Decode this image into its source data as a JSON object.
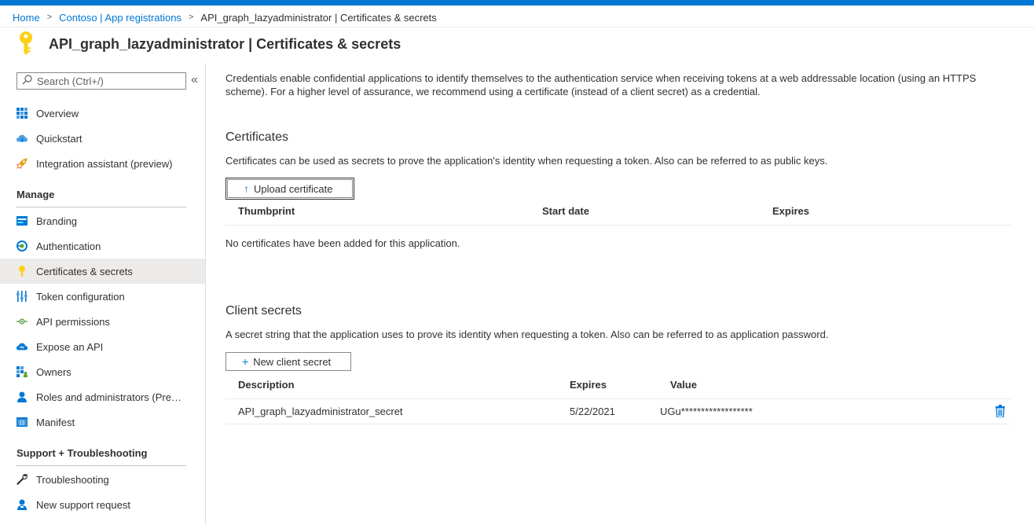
{
  "breadcrumb": {
    "home": "Home",
    "parent": "Contoso | App registrations",
    "current": "API_graph_lazyadministrator | Certificates & secrets"
  },
  "page": {
    "title": "API_graph_lazyadministrator | Certificates & secrets"
  },
  "sidebar": {
    "search_placeholder": "Search (Ctrl+/)",
    "collapse_glyph": "«",
    "top_items": [
      {
        "label": "Overview",
        "icon": "overview-icon"
      },
      {
        "label": "Quickstart",
        "icon": "quickstart-icon"
      },
      {
        "label": "Integration assistant (preview)",
        "icon": "rocket-icon"
      }
    ],
    "manage_header": "Manage",
    "manage_items": [
      {
        "label": "Branding",
        "icon": "branding-icon"
      },
      {
        "label": "Authentication",
        "icon": "authentication-icon"
      },
      {
        "label": "Certificates & secrets",
        "icon": "key-icon",
        "selected": true
      },
      {
        "label": "Token configuration",
        "icon": "token-icon"
      },
      {
        "label": "API permissions",
        "icon": "api-permissions-icon"
      },
      {
        "label": "Expose an API",
        "icon": "cloud-icon"
      },
      {
        "label": "Owners",
        "icon": "owners-icon"
      },
      {
        "label": "Roles and administrators (Previ...",
        "icon": "roles-icon"
      },
      {
        "label": "Manifest",
        "icon": "manifest-icon"
      }
    ],
    "support_header": "Support + Troubleshooting",
    "support_items": [
      {
        "label": "Troubleshooting",
        "icon": "wrench-icon"
      },
      {
        "label": "New support request",
        "icon": "support-person-icon"
      }
    ]
  },
  "main": {
    "intro": "Credentials enable confidential applications to identify themselves to the authentication service when receiving tokens at a web addressable location (using an HTTPS scheme). For a higher level of assurance, we recommend using a certificate (instead of a client secret) as a credential.",
    "certificates": {
      "heading": "Certificates",
      "description": "Certificates can be used as secrets to prove the application's identity when requesting a token. Also can be referred to as public keys.",
      "upload_label": "Upload certificate",
      "columns": [
        "Thumbprint",
        "Start date",
        "Expires"
      ],
      "empty_message": "No certificates have been added for this application."
    },
    "client_secrets": {
      "heading": "Client secrets",
      "description": "A secret string that the application uses to prove its identity when requesting a token. Also can be referred to as application password.",
      "new_label": "New client secret",
      "columns": [
        "Description",
        "Expires",
        "Value"
      ],
      "rows": [
        {
          "description": "API_graph_lazyadministrator_secret",
          "expires": "5/22/2021",
          "value": "UGu******************"
        }
      ]
    }
  },
  "colors": {
    "accent": "#0078d4",
    "key_yellow": "#fcd116",
    "selected_bg": "#edebe9"
  }
}
